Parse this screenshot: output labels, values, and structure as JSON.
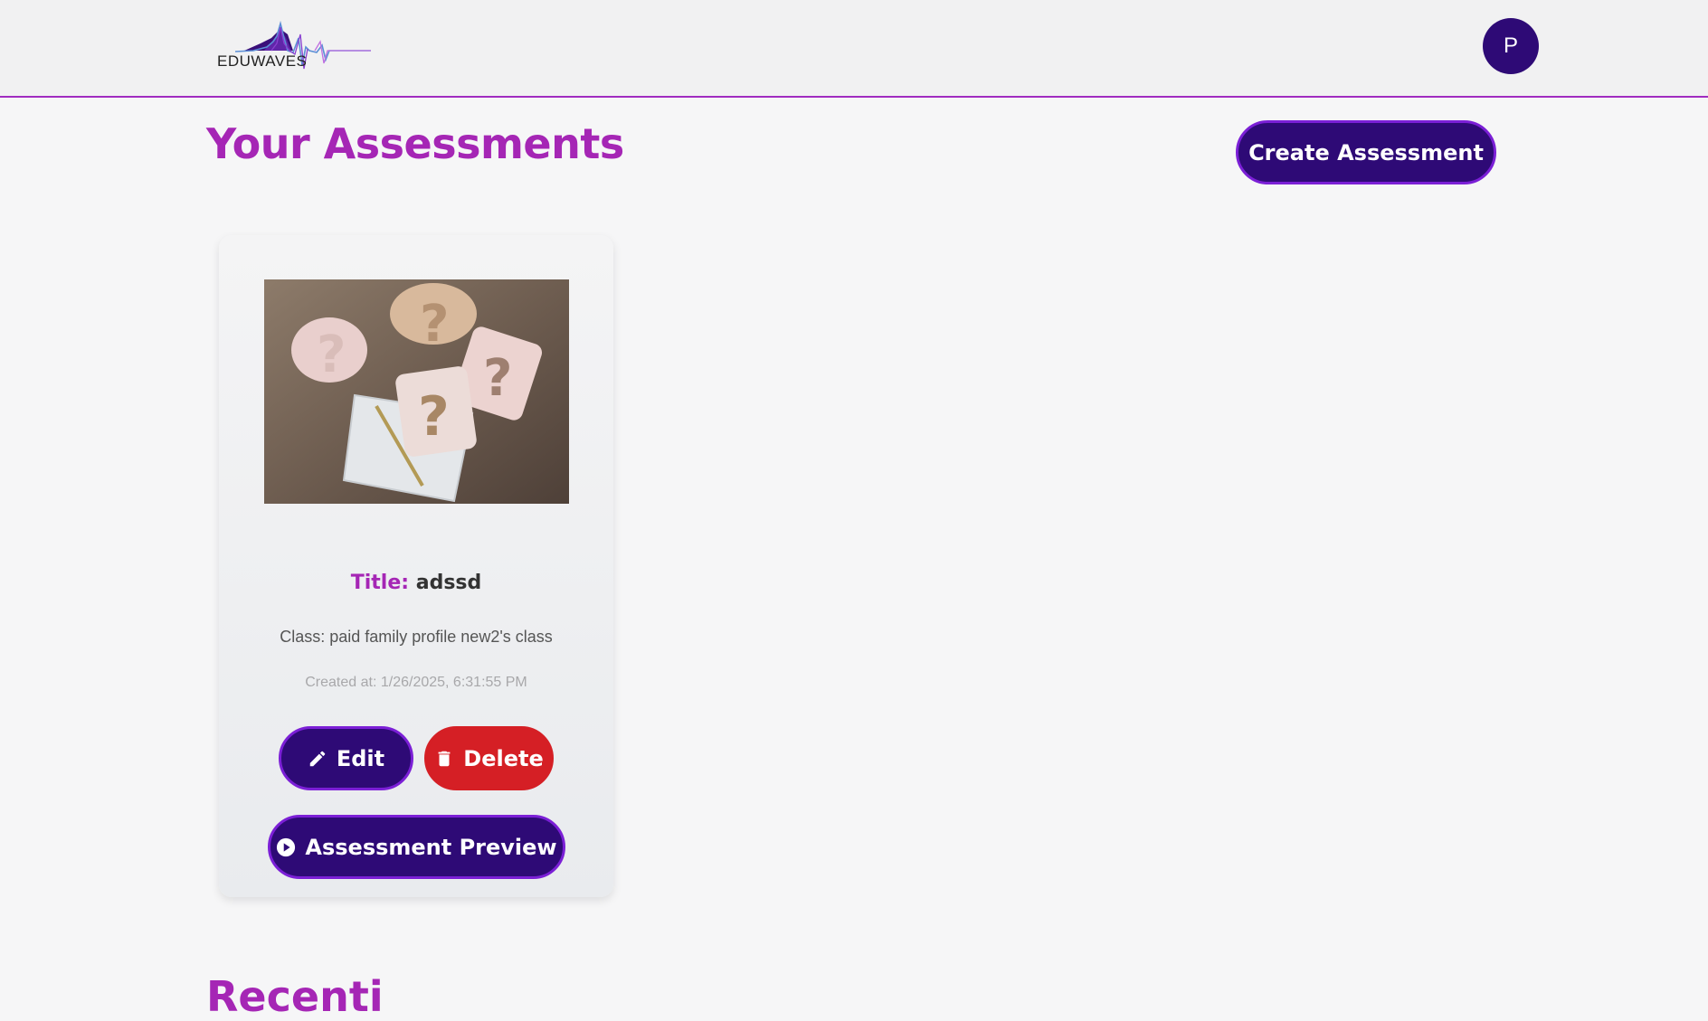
{
  "header": {
    "logo_text": "EDUWAVES",
    "avatar_initial": "P"
  },
  "main": {
    "title": "Your Assessments",
    "create_label": "Create Assessment",
    "next_section_title_partial": "Recenti"
  },
  "assessments": [
    {
      "title_label": "Title:",
      "title": "adssd",
      "class_text": "Class: paid family profile new2's class",
      "created_text": "Created at: 1/26/2025, 6:31:55 PM",
      "edit_label": "Edit",
      "delete_label": "Delete",
      "preview_label": "Assessment Preview"
    }
  ],
  "colors": {
    "accent": "#a526b5",
    "primary": "#2e0a76",
    "danger": "#d51f25"
  }
}
